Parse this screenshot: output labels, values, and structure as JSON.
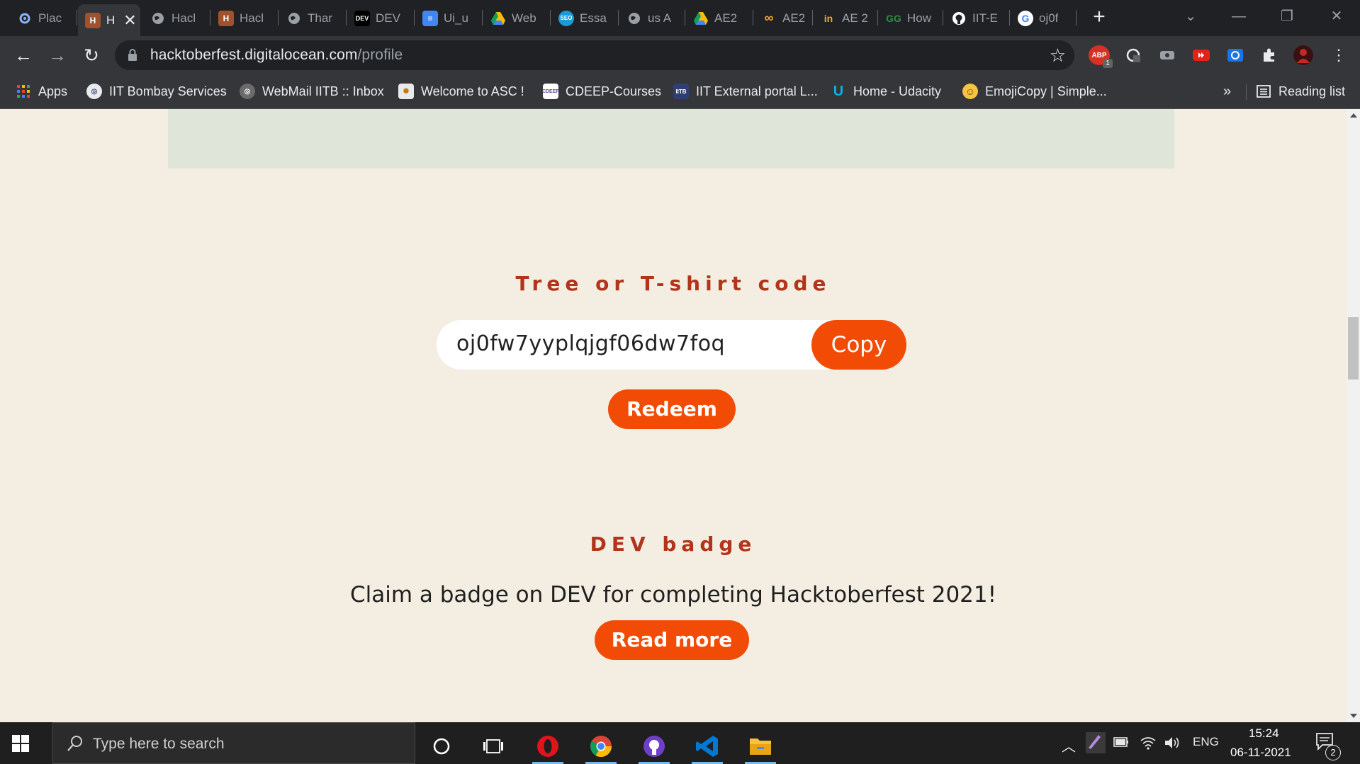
{
  "browser": {
    "tabs": [
      {
        "title": "Plac",
        "icon": "settings-gear-icon",
        "color": "#8ab4f8"
      },
      {
        "title": "H",
        "icon": "hacktoberfest-icon",
        "color": "#e8a87c",
        "active": true
      },
      {
        "title": "Hacl",
        "icon": "globe-icon",
        "color": "#9aa0a6"
      },
      {
        "title": "Hacl",
        "icon": "hacktoberfest-icon",
        "color": "#e8a87c"
      },
      {
        "title": "Thar",
        "icon": "globe-icon",
        "color": "#9aa0a6"
      },
      {
        "title": "DEV",
        "icon": "dev-icon",
        "color": "#000000"
      },
      {
        "title": "Ui_u",
        "icon": "docs-icon",
        "color": "#4285f4"
      },
      {
        "title": "Web",
        "icon": "drive-icon",
        "color": "#fbbc04"
      },
      {
        "title": "Essa",
        "icon": "seo-icon",
        "color": "#1a9bd7"
      },
      {
        "title": "us A",
        "icon": "globe-icon",
        "color": "#9aa0a6"
      },
      {
        "title": "AE2",
        "icon": "drive-icon",
        "color": "#fbbc04"
      },
      {
        "title": "AE2",
        "icon": "infinity-icon",
        "color": "#f5a623"
      },
      {
        "title": "AE 2",
        "icon": "in-icon",
        "color": "#f5a623"
      },
      {
        "title": "How",
        "icon": "geeks-icon",
        "color": "#2f8d46"
      },
      {
        "title": "IIT-E",
        "icon": "github-icon",
        "color": "#ffffff"
      },
      {
        "title": "oj0f",
        "icon": "google-icon",
        "color": "#ffffff"
      }
    ],
    "url_host": "hacktoberfest.digitalocean.com",
    "url_path": "/profile",
    "extensions": [
      {
        "name": "adblock-icon",
        "label": "ABP",
        "color": "#d93025"
      },
      {
        "name": "extension-2-icon",
        "label": "",
        "color": "#5f6368"
      },
      {
        "name": "extension-3-icon",
        "label": "",
        "color": "#5f6368"
      },
      {
        "name": "youtube-extension-icon",
        "label": "",
        "color": "#e62117"
      },
      {
        "name": "screen-capture-icon",
        "label": "",
        "color": "#1a73e8"
      },
      {
        "name": "puzzle-icon",
        "label": "",
        "color": "#35363a"
      },
      {
        "name": "profile-avatar-icon",
        "label": "",
        "color": "#202124"
      }
    ],
    "abp_count": "1"
  },
  "bookmarks": {
    "items": [
      {
        "label": "Apps",
        "icon": "apps-grid-icon",
        "color": "#ea4335"
      },
      {
        "label": "IIT Bombay Services",
        "icon": "iitb-icon",
        "color": "#8ab4f8"
      },
      {
        "label": "WebMail IITB :: Inbox",
        "icon": "iitb-icon",
        "color": "#8a8a8a"
      },
      {
        "label": "Welcome to ASC !",
        "icon": "asc-icon",
        "color": "#e8eaed"
      },
      {
        "label": "CDEEP-Courses",
        "icon": "cdeep-icon",
        "color": "#ffffff"
      },
      {
        "label": "IIT External portal L...",
        "icon": "iitb-icon",
        "color": "#4b6cb7"
      },
      {
        "label": "Home - Udacity",
        "icon": "udacity-icon",
        "color": "#02b3e4"
      },
      {
        "label": "EmojiCopy | Simple...",
        "icon": "emoji-icon",
        "color": "#f5c542"
      }
    ],
    "overflow": "»",
    "reading_list": "Reading list"
  },
  "page": {
    "tshirt_title": "Tree or T-shirt code",
    "code": "oj0fw7yyplqjgf06dw7foq",
    "copy_label": "Copy",
    "redeem_label": "Redeem",
    "badge_title": "DEV badge",
    "badge_desc": "Claim a badge on DEV for completing Hacktoberfest 2021!",
    "read_more_label": "Read more",
    "accent_color": "#f24b05",
    "title_color": "#b3331b",
    "background_color": "#f3eee1"
  },
  "taskbar": {
    "search_placeholder": "Type here to search",
    "apps": [
      "cortana-icon",
      "task-view-icon",
      "opera-icon",
      "chrome-icon",
      "github-desktop-icon",
      "vscode-icon",
      "file-explorer-icon"
    ],
    "language": "ENG",
    "time": "15:24",
    "date": "06-11-2021",
    "notification_count": "2"
  }
}
